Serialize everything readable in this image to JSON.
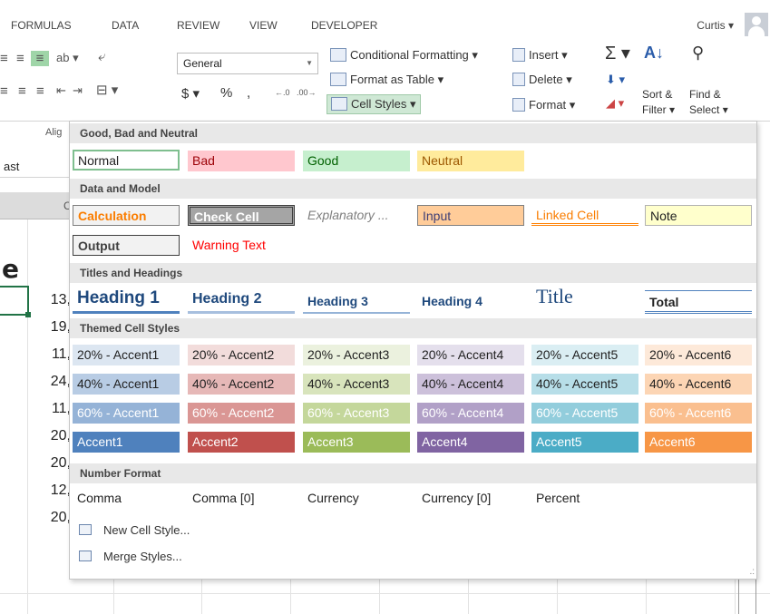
{
  "ribbon_tabs": [
    "FORMULAS",
    "DATA",
    "REVIEW",
    "VIEW",
    "DEVELOPER"
  ],
  "user_name": "Curtis",
  "number_format": "General",
  "ribbon": {
    "conditional_formatting": "Conditional Formatting",
    "format_as_table": "Format as Table",
    "cell_styles": "Cell Styles",
    "insert": "Insert",
    "delete": "Delete",
    "format": "Format",
    "sort_filter_line1": "Sort &",
    "sort_filter_line2": "Filter",
    "find_select_line1": "Find &",
    "find_select_line2": "Select",
    "currency_symbol": "$",
    "percent_symbol": "%",
    "comma_symbol": ",",
    "inc_decimal": "←.0",
    "dec_decimal": ".00→",
    "align_group_label": "Alig"
  },
  "sheet": {
    "name_box_text": "ast",
    "column_header_letter": "C",
    "big_letter": "e",
    "row_values": [
      "13,",
      "19,",
      "11,",
      "24,",
      "11,",
      "20,",
      "20,",
      "12,",
      "20,"
    ]
  },
  "cell_styles_menu": {
    "sections": {
      "good_bad_neutral": "Good, Bad and Neutral",
      "data_model": "Data and Model",
      "titles_headings": "Titles and Headings",
      "themed": "Themed Cell Styles",
      "number_format": "Number Format"
    },
    "good_bad_neutral": [
      "Normal",
      "Bad",
      "Good",
      "Neutral"
    ],
    "data_model_row1": [
      "Calculation",
      "Check Cell",
      "Explanatory ...",
      "Input",
      "Linked Cell",
      "Note"
    ],
    "data_model_row2": [
      "Output",
      "Warning Text"
    ],
    "titles": [
      "Heading 1",
      "Heading 2",
      "Heading 3",
      "Heading 4",
      "Title",
      "Total"
    ],
    "themed_20": [
      "20% - Accent1",
      "20% - Accent2",
      "20% - Accent3",
      "20% - Accent4",
      "20% - Accent5",
      "20% - Accent6"
    ],
    "themed_40": [
      "40% - Accent1",
      "40% - Accent2",
      "40% - Accent3",
      "40% - Accent4",
      "40% - Accent5",
      "40% - Accent6"
    ],
    "themed_60": [
      "60% - Accent1",
      "60% - Accent2",
      "60% - Accent3",
      "60% - Accent4",
      "60% - Accent5",
      "60% - Accent6"
    ],
    "themed_accent": [
      "Accent1",
      "Accent2",
      "Accent3",
      "Accent4",
      "Accent5",
      "Accent6"
    ],
    "number_formats": [
      "Comma",
      "Comma [0]",
      "Currency",
      "Currency [0]",
      "Percent"
    ],
    "new_cell_style": "New Cell Style...",
    "merge_styles": "Merge Styles..."
  },
  "colors": {
    "accent1": "#4f81bd",
    "accent2": "#c0504d",
    "accent3": "#9bbb59",
    "accent4": "#8064a2",
    "accent5": "#4bacc6",
    "accent6": "#f79646",
    "excel_green": "#217346"
  }
}
